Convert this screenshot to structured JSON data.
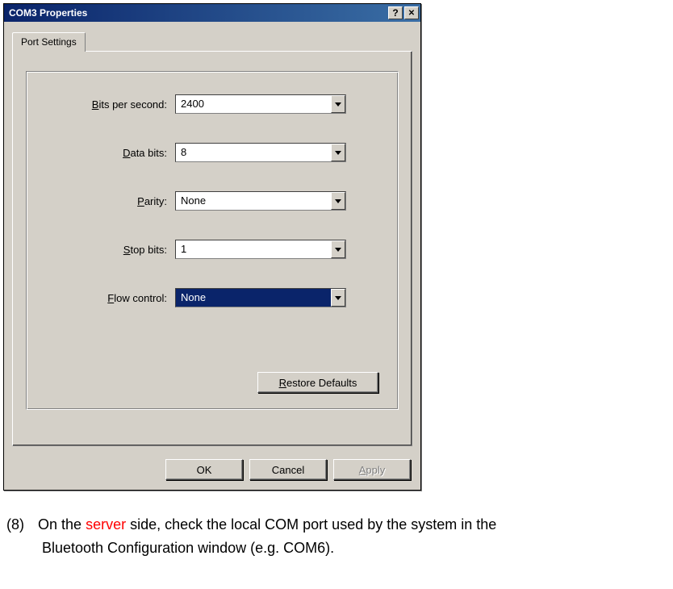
{
  "dialog": {
    "title": "COM3 Properties",
    "help_symbol": "?",
    "close_symbol": "✕",
    "tab": {
      "label": "Port Settings"
    },
    "fields": {
      "bits_per_second": {
        "prefix": "B",
        "rest": "its per second:",
        "value": "2400"
      },
      "data_bits": {
        "prefix": "D",
        "rest": "ata bits:",
        "value": "8"
      },
      "parity": {
        "prefix": "P",
        "rest": "arity:",
        "value": "None"
      },
      "stop_bits": {
        "prefix": "S",
        "rest": "top bits:",
        "value": "1"
      },
      "flow_control": {
        "prefix": "F",
        "rest": "low control:",
        "value": "None",
        "highlighted": true
      }
    },
    "restore_defaults": {
      "prefix": "R",
      "rest": "estore Defaults"
    },
    "buttons": {
      "ok": "OK",
      "cancel": "Cancel",
      "apply": {
        "prefix": "A",
        "rest": "pply"
      }
    }
  },
  "instruction": {
    "number": "(8)",
    "pre": "On the ",
    "red": "server",
    "post": " side, check the local COM port used by the system in the",
    "line2": "Bluetooth Configuration window (e.g. COM6)."
  }
}
